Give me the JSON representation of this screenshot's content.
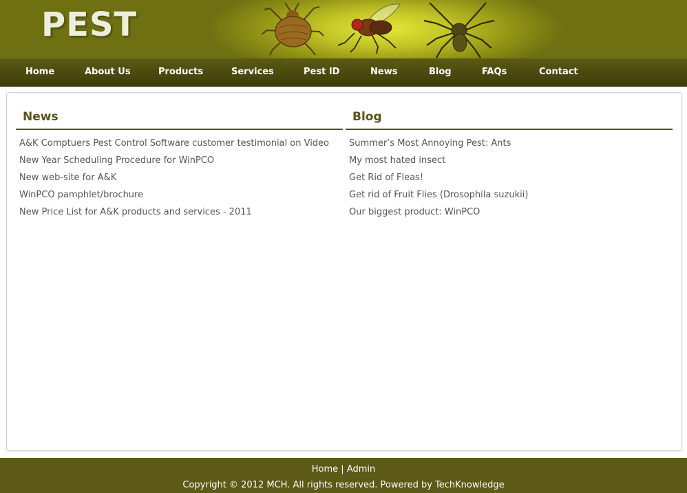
{
  "site": {
    "logo_text": "PEST"
  },
  "header": {
    "insects": [
      "bedbug-image",
      "fly-image",
      "spider-image"
    ]
  },
  "nav": {
    "items": [
      "Home",
      "About Us",
      "Products",
      "Services",
      "Pest ID",
      "News",
      "Blog",
      "FAQs",
      "Contact"
    ]
  },
  "news": {
    "title": "News",
    "items": [
      "A&K Comptuers Pest Control Software customer testimonial on Video",
      "New Year Scheduling Procedure for WinPCO",
      "New web-site for A&K",
      "WinPCO pamphlet/brochure",
      "New Price List for A&K products and services - 2011"
    ]
  },
  "blog": {
    "title": "Blog",
    "items": [
      "Summer’s Most Annoying Pest: Ants",
      "My most hated insect",
      "Get Rid of Fleas!",
      "Get rid of Fruit Flies (Drosophila suzukii)",
      "Our biggest product: WinPCO"
    ]
  },
  "footer": {
    "link_home": "Home",
    "separator": "|",
    "link_admin": "Admin",
    "copyright": "Copyright © 2012 MCH. All rights reserved. Powered by TechKnowledge"
  },
  "colors": {
    "header_light": "#e4e838",
    "header_dark": "#6e7011",
    "nav_bg": "#4b4a10",
    "heading": "#5a5316",
    "footer_bg": "#5d5916"
  }
}
